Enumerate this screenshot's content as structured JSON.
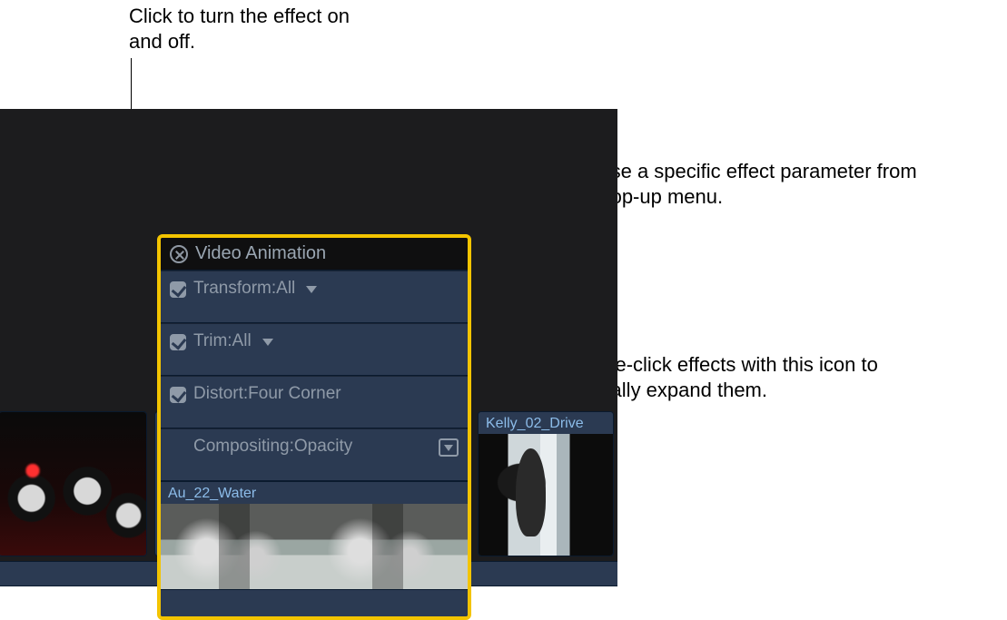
{
  "callouts": {
    "top": "Click to turn the effect on and off.",
    "right1": "Choose a specific effect parameter from this pop-up menu.",
    "right2": "Double-click effects with this icon to vertically expand them."
  },
  "panel": {
    "title": "Video Animation",
    "rows": [
      {
        "label": "Transform:All",
        "checked": true,
        "has_menu": true,
        "expandable": false
      },
      {
        "label": "Trim:All",
        "checked": true,
        "has_menu": true,
        "expandable": false
      },
      {
        "label": "Distort:Four Corner",
        "checked": true,
        "has_menu": false,
        "expandable": false
      },
      {
        "label": "Compositing:Opacity",
        "checked": false,
        "has_menu": false,
        "expandable": true
      }
    ]
  },
  "clips": {
    "center_label": "Au_22_Water",
    "right_label": "Kelly_02_Drive"
  }
}
